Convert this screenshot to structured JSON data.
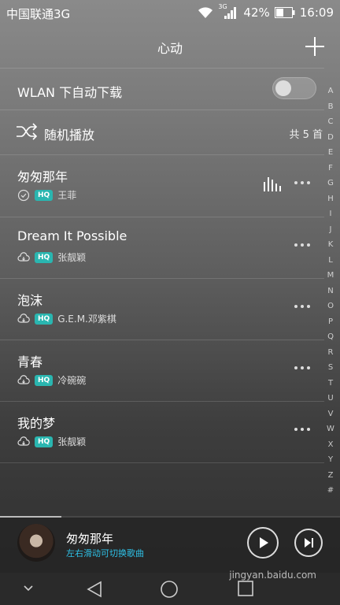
{
  "status_bar": {
    "carrier": "中国联通3G",
    "network": "3G",
    "battery": "42%",
    "time": "16:09"
  },
  "header": {
    "title": "心动"
  },
  "wlan": {
    "label": "WLAN 下自动下载",
    "enabled": false
  },
  "shuffle": {
    "label": "随机播放",
    "count": "共 5 首"
  },
  "songs": [
    {
      "title": "匆匆那年",
      "artist": "王菲",
      "hq": "HQ",
      "downloaded": true,
      "playing": true
    },
    {
      "title": "Dream It Possible",
      "artist": "张靓颖",
      "hq": "HQ",
      "downloaded": false,
      "playing": false
    },
    {
      "title": "泡沫",
      "artist": "G.E.M.邓紫棋",
      "hq": "HQ",
      "downloaded": false,
      "playing": false
    },
    {
      "title": "青春",
      "artist": "冷碗碗",
      "hq": "HQ",
      "downloaded": false,
      "playing": false
    },
    {
      "title": "我的梦",
      "artist": "张靓颖",
      "hq": "HQ",
      "downloaded": false,
      "playing": false
    }
  ],
  "alphabet": [
    "A",
    "B",
    "C",
    "D",
    "E",
    "F",
    "G",
    "H",
    "I",
    "J",
    "K",
    "L",
    "M",
    "N",
    "O",
    "P",
    "Q",
    "R",
    "S",
    "T",
    "U",
    "V",
    "W",
    "X",
    "Y",
    "Z",
    "#"
  ],
  "now_playing": {
    "title": "匆匆那年",
    "hint": "左右滑动可切换歌曲",
    "progress": 0.18
  },
  "watermark": "jingyan.baidu.com",
  "colors": {
    "accent": "#2ab6b0",
    "hint": "#2ec2e8"
  }
}
